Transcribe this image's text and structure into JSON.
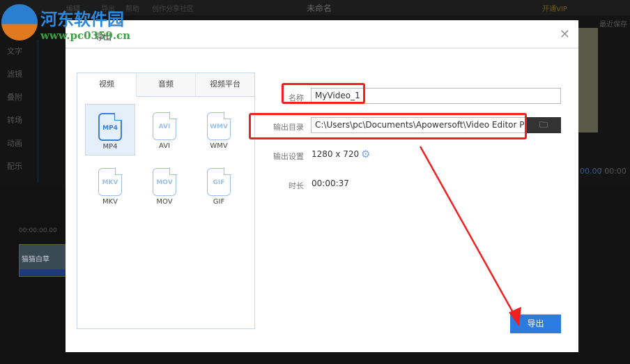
{
  "app": {
    "window_title": "未命名",
    "menu": [
      "编辑",
      "导出",
      "帮助",
      "创作分享社区"
    ],
    "vip": "开通VIP",
    "recent": "最近保存",
    "side_items": [
      "文字",
      "滤镜",
      "叠附",
      "转场",
      "动画",
      "配乐"
    ],
    "timecode": "00:00:00.00",
    "clip_label": "猫猫白草",
    "play_time": "00.00",
    "total_time": "/ 00:00"
  },
  "watermark": {
    "name": "河东软件园",
    "url": "www.pc0359.cn"
  },
  "dialog": {
    "title": "导出",
    "tabs": [
      "视频",
      "音频",
      "视频平台"
    ],
    "formats": [
      {
        "name": "MP4",
        "selected": true
      },
      {
        "name": "AVI"
      },
      {
        "name": "WMV"
      },
      {
        "name": "MKV"
      },
      {
        "name": "MOV"
      },
      {
        "name": "GIF"
      }
    ],
    "name_label": "名称",
    "name_value": "MyVideo_1",
    "dir_label": "输出目录",
    "dir_value": "C:\\Users\\pc\\Documents\\Apowersoft\\Video Editor Pro\\",
    "settings_label": "输出设置",
    "settings_value": "1280 x 720",
    "duration_label": "时长",
    "duration_value": "00:00:37",
    "export_label": "导出"
  },
  "colors": {
    "accent": "#2a7ce0",
    "annotation": "#f02020"
  }
}
